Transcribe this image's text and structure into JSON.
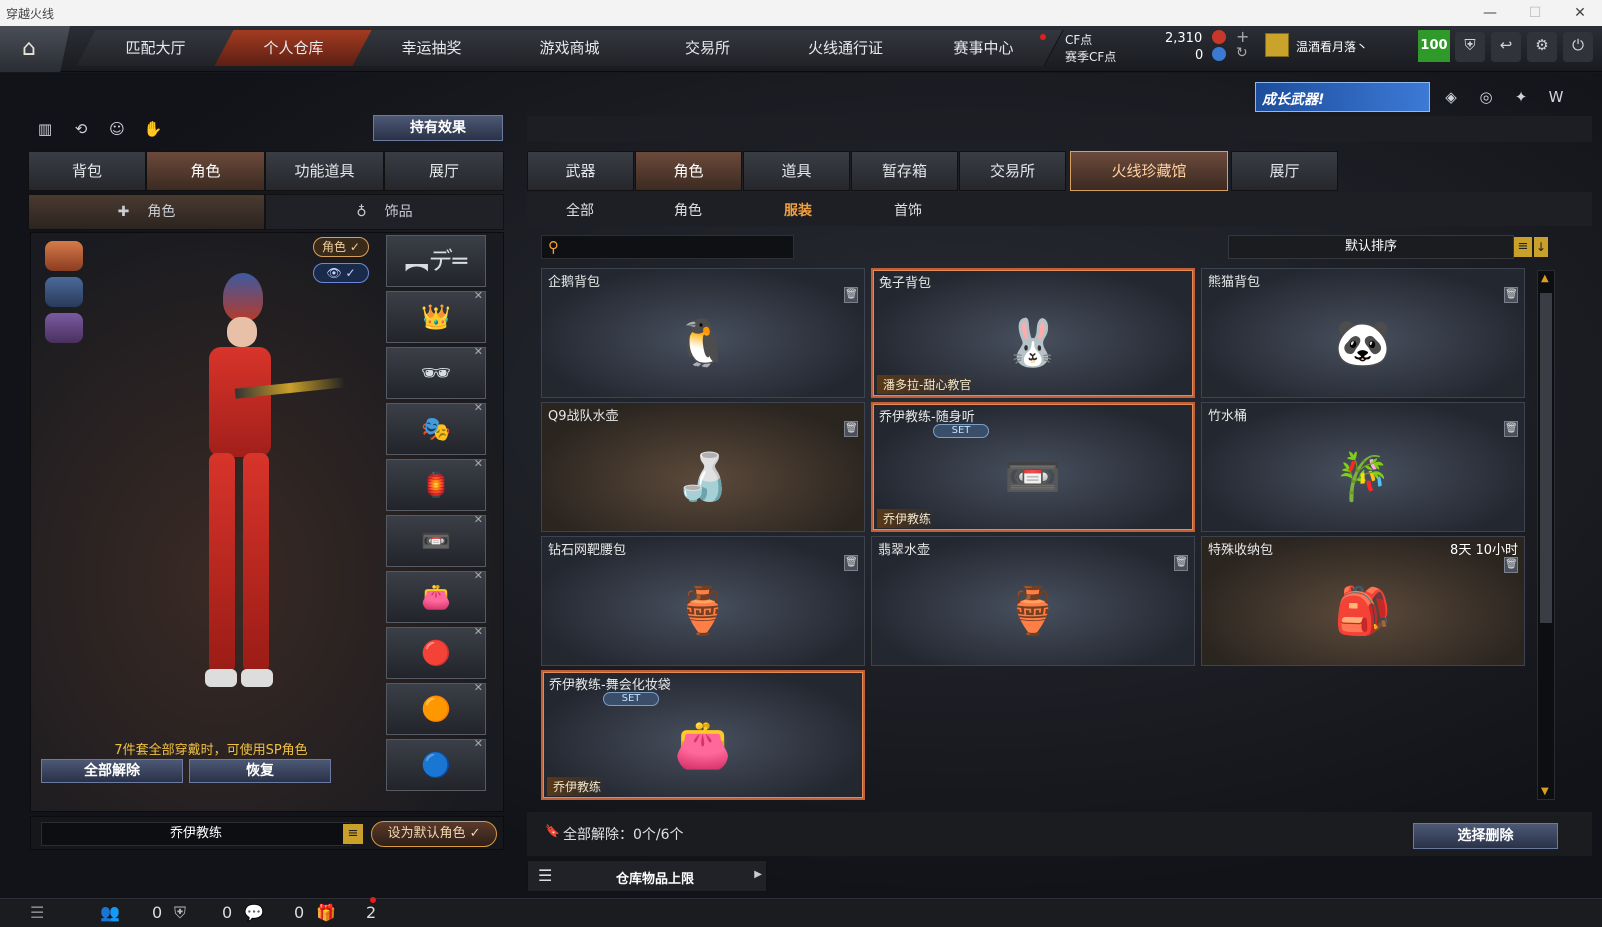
{
  "window": {
    "title": "穿越火线"
  },
  "topnav": {
    "tabs": [
      "匹配大厅",
      "个人仓库",
      "幸运抽奖",
      "游戏商城",
      "交易所",
      "火线通行证",
      "赛事中心"
    ],
    "cf_label": "CF点",
    "cf_value": "2,310",
    "season_label": "赛季CF点",
    "season_value": "0",
    "username": "温酒看月落丶",
    "level": "100"
  },
  "banner": {
    "text": "成长武器!"
  },
  "left": {
    "hold_effect": "持有效果",
    "tabs": [
      "背包",
      "角色",
      "功能道具",
      "展厅"
    ],
    "subtabs": [
      "角色",
      "饰品"
    ],
    "char_badge": "角色",
    "notice": "7件套全部穿戴时，可使用SP角色",
    "unequip_all": "全部解除",
    "restore": "恢复",
    "char_name": "乔伊教练",
    "set_default": "设为默认角色"
  },
  "right": {
    "tabs": [
      "武器",
      "角色",
      "道具",
      "暂存箱",
      "交易所",
      "火线珍藏馆",
      "展厅"
    ],
    "subtabs": [
      "全部",
      "角色",
      "服装",
      "首饰"
    ],
    "sort": "默认排序",
    "search_placeholder": "",
    "items": [
      {
        "name": "企鹅背包",
        "icon": "🐧"
      },
      {
        "name": "兔子背包",
        "icon": "🐰",
        "tag": "潘多拉-甜心教官"
      },
      {
        "name": "熊猫背包",
        "icon": "🐼"
      },
      {
        "name": "Q9战队水壶",
        "icon": "🍶"
      },
      {
        "name": "乔伊教练-随身听",
        "icon": "📼",
        "set": "SET",
        "tag": "乔伊教练"
      },
      {
        "name": "竹水桶",
        "icon": "🎋"
      },
      {
        "name": "钻石网靶腰包",
        "icon": "🏺"
      },
      {
        "name": "翡翠水壶",
        "icon": "🏺"
      },
      {
        "name": "特殊收纳包",
        "icon": "🎒",
        "time": "8天 10小时"
      },
      {
        "name": "乔伊教练-舞会化妆袋",
        "icon": "👛",
        "set": "SET",
        "tag": "乔伊教练"
      }
    ],
    "footer_text": "全部解除：0个/6个",
    "select_delete": "选择删除",
    "storage_limit": "仓库物品上限"
  },
  "status": {
    "c1": "0",
    "c2": "0",
    "c3": "0",
    "c4": "2"
  }
}
